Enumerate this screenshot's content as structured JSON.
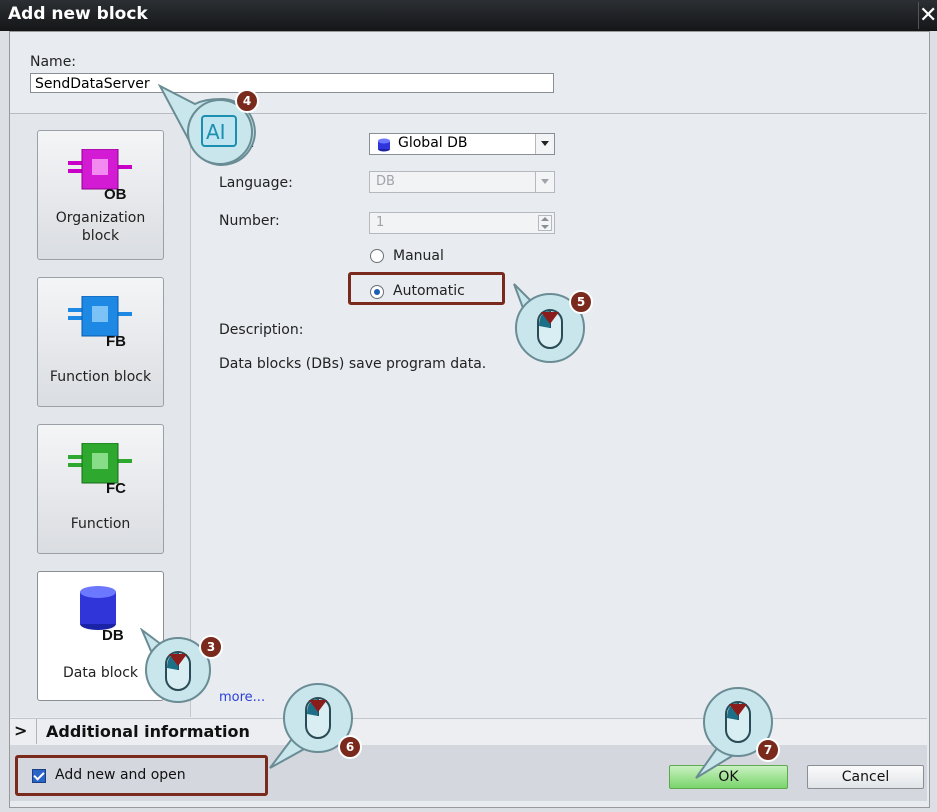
{
  "window": {
    "title": "Add new block",
    "close_glyph": "✕"
  },
  "form": {
    "name_label": "Name:",
    "name_value": "SendDataServer",
    "type_label_partial": ":",
    "type_value": "Global DB",
    "language_label": "Language:",
    "language_value": "DB",
    "number_label": "Number:",
    "number_value": "1",
    "radio_manual": "Manual",
    "radio_automatic": "Automatic",
    "numbering_mode": "Automatic",
    "description_label": "Description:",
    "description_text": "Data blocks (DBs) save program data.",
    "more_link": "more..."
  },
  "block_types": [
    {
      "label": "Organization block",
      "tag": "OB",
      "color": "#c800c8",
      "selected": false
    },
    {
      "label": "Function block",
      "tag": "FB",
      "color": "#1e88e5",
      "selected": false
    },
    {
      "label": "Function",
      "tag": "FC",
      "color": "#2ea82e",
      "selected": false
    },
    {
      "label": "Data block",
      "tag": "DB",
      "color": "#2f35d8",
      "selected": true
    }
  ],
  "additional": {
    "label": "Additional  information"
  },
  "footer": {
    "checkbox_label": "Add new and open",
    "checkbox_checked": true,
    "ok_label": "OK",
    "cancel_label": "Cancel"
  },
  "callouts": [
    {
      "step": "3",
      "kind": "mouse-click"
    },
    {
      "step": "4",
      "kind": "text-input"
    },
    {
      "step": "5",
      "kind": "mouse-click"
    },
    {
      "step": "6",
      "kind": "mouse-click"
    },
    {
      "step": "7",
      "kind": "mouse-click"
    }
  ],
  "colors": {
    "callout_fill": "#c8e6ec",
    "badge": "#7a2a1c",
    "ok_green": "#7ad56b"
  }
}
